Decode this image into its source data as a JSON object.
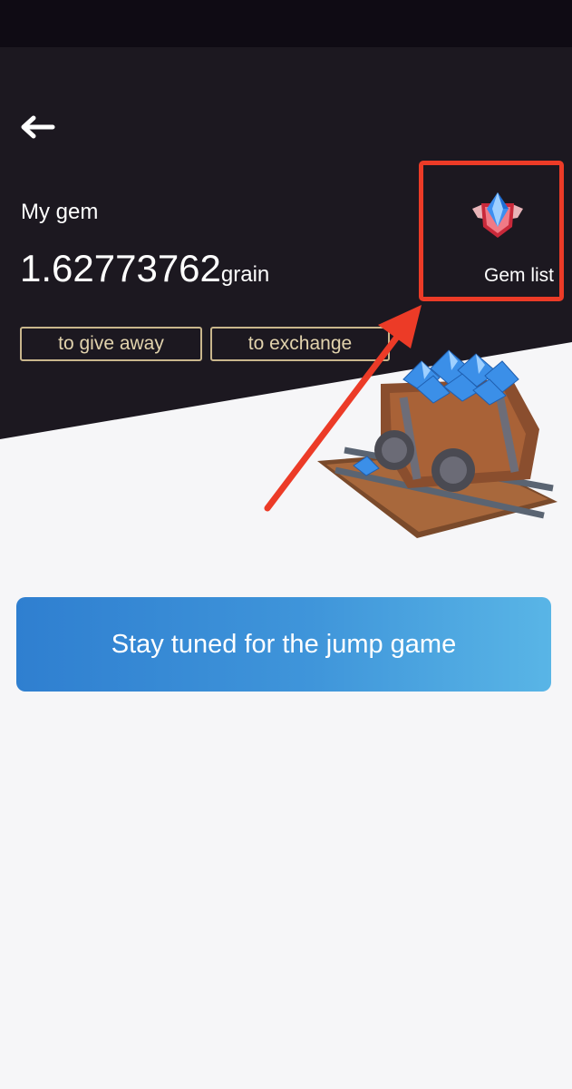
{
  "header": {
    "back_icon": "back-arrow-icon"
  },
  "gem": {
    "label": "My gem",
    "amount": "1.62773762",
    "unit": "grain"
  },
  "actions": {
    "give_away": "to give away",
    "exchange": "to exchange"
  },
  "gem_list": {
    "label": "Gem list",
    "icon": "gem-badge-icon",
    "highlight_color": "#ec3b27"
  },
  "main": {
    "jump_game_label": "Stay tuned for the jump game"
  },
  "colors": {
    "header_bg": "#1c1820",
    "button_border": "#c9b68c",
    "primary_button": "#3f95da"
  }
}
